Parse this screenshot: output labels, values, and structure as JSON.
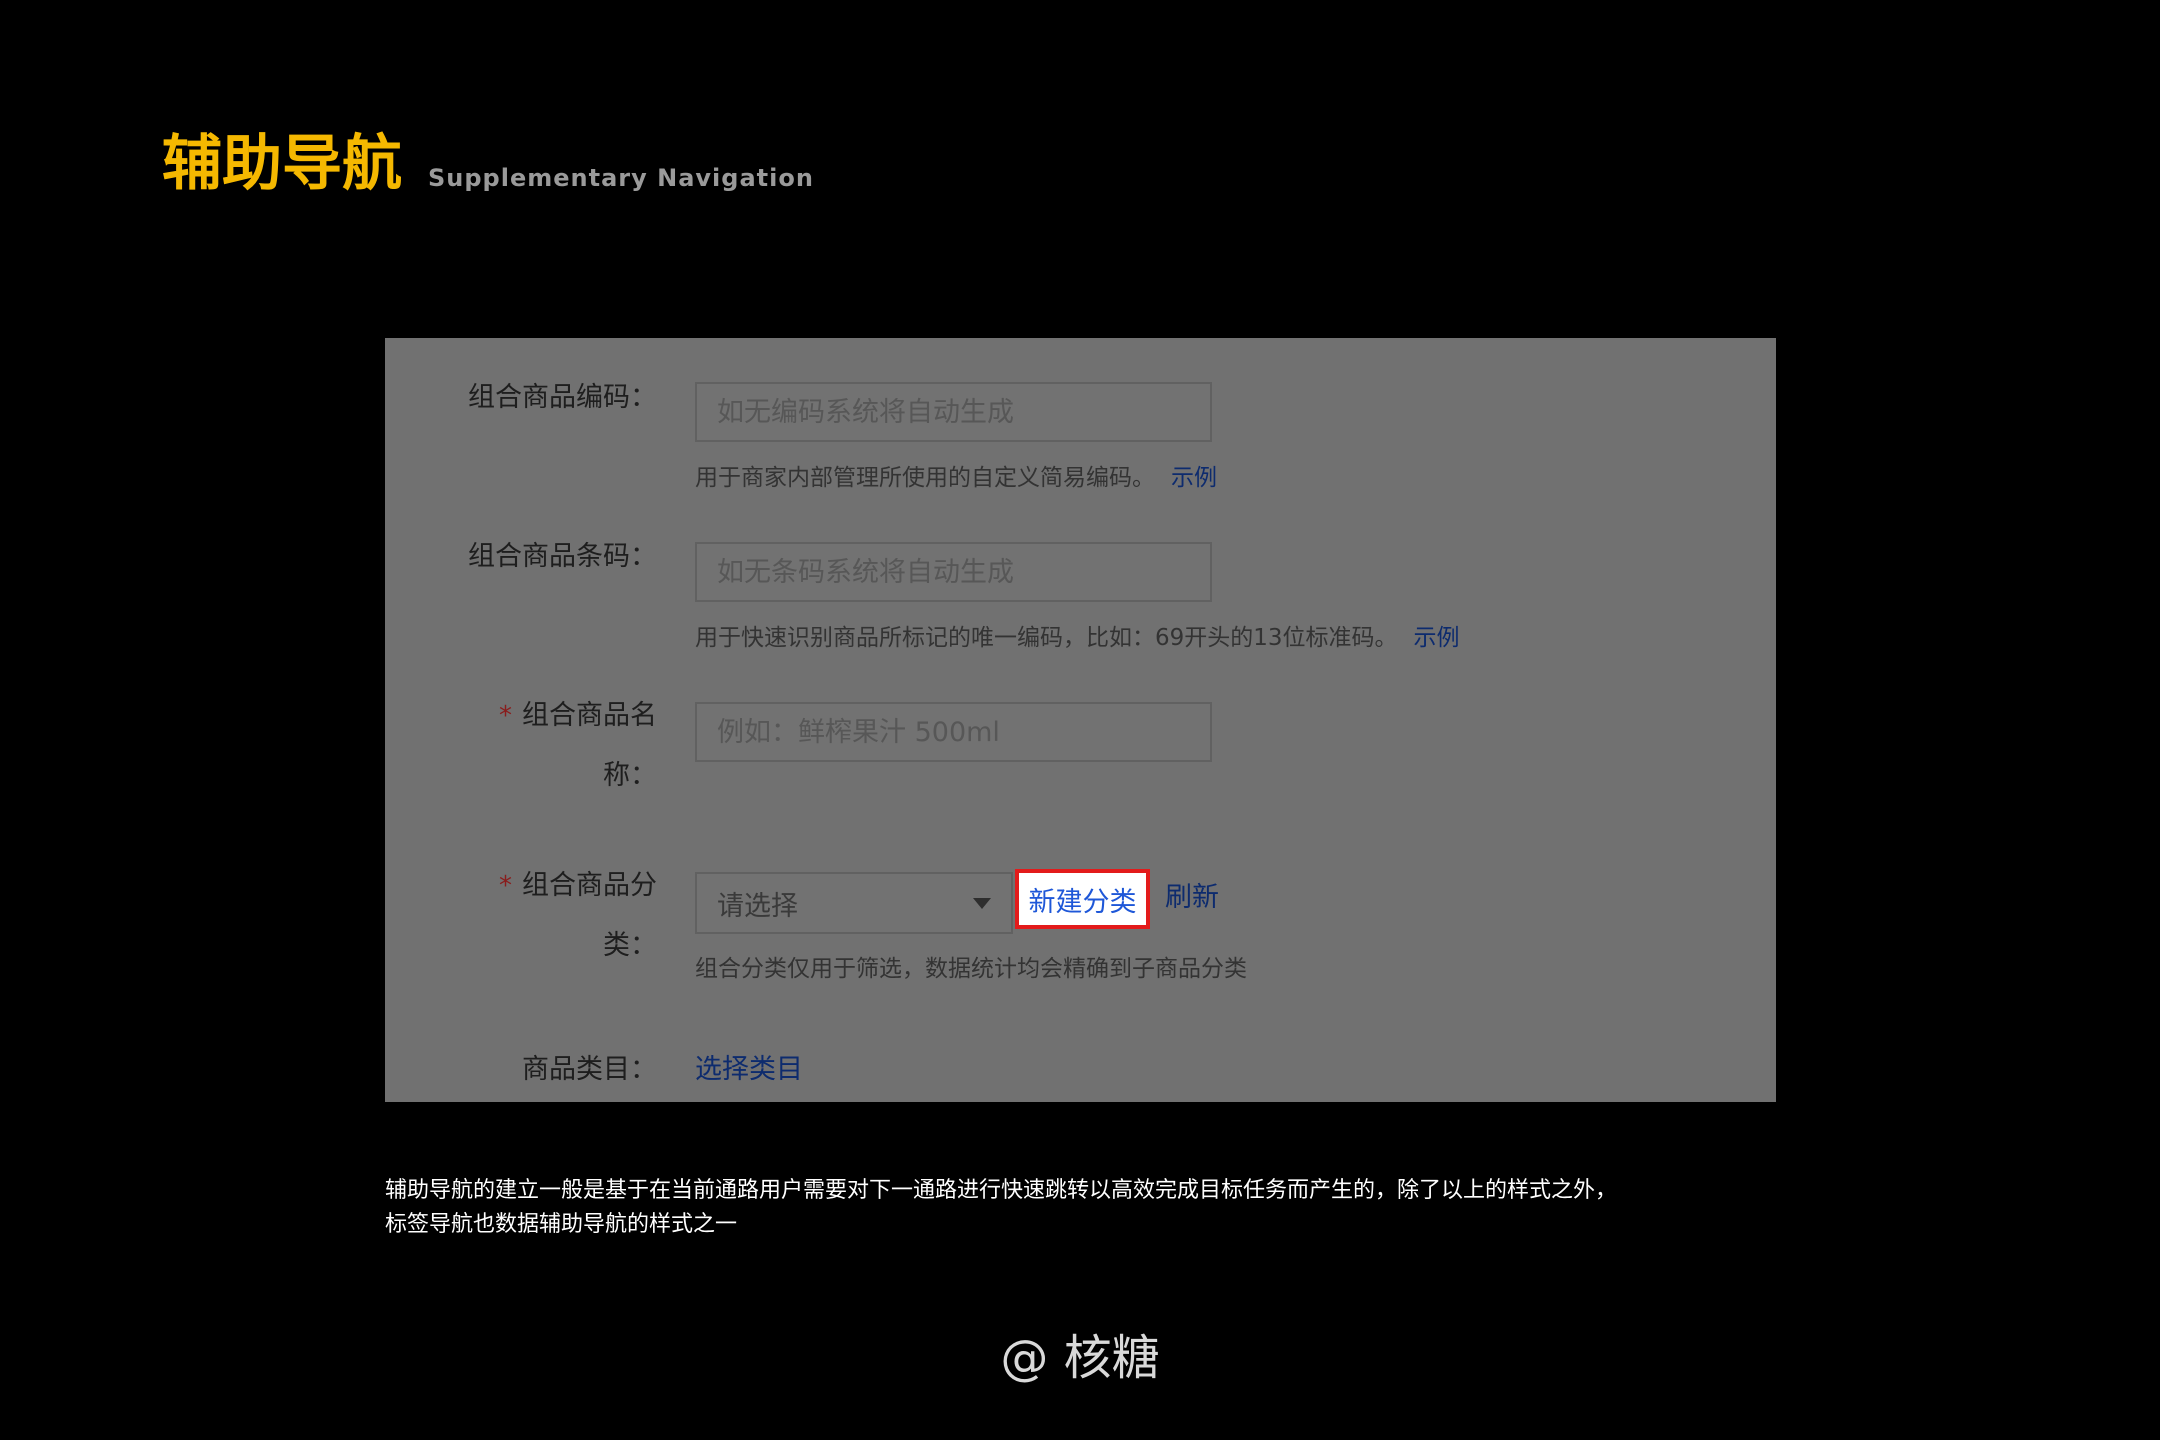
{
  "header": {
    "title": "辅助导航",
    "subtitle": "Supplementary Navigation"
  },
  "form": {
    "code": {
      "label": "组合商品编码：",
      "placeholder": "如无编码系统将自动生成",
      "hint": "用于商家内部管理所使用的自定义简易编码。",
      "example_link": "示例"
    },
    "barcode": {
      "label": "组合商品条码：",
      "placeholder": "如无条码系统将自动生成",
      "hint": "用于快速识别商品所标记的唯一编码，比如：69开头的13位标准码。",
      "example_link": "示例"
    },
    "name": {
      "required_mark": "*",
      "label_line1": "组合商品名",
      "label_line2": "称：",
      "placeholder": "例如：鲜榨果汁 500ml"
    },
    "category": {
      "required_mark": "*",
      "label_line1": "组合商品分",
      "label_line2": "类：",
      "select_value": "请选择",
      "new_category": "新建分类",
      "refresh": "刷新",
      "hint": "组合分类仅用于筛选，数据统计均会精确到子商品分类"
    },
    "product_category": {
      "label": "商品类目：",
      "link": "选择类目"
    }
  },
  "description": {
    "line1": "辅助导航的建立一般是基于在当前通路用户需要对下一通路进行快速跳转以高效完成目标任务而产生的，除了以上的样式之外，",
    "line2": "标签导航也数据辅助导航的样式之一"
  },
  "credit": "@ 核糖",
  "colors": {
    "background": "#000000",
    "title": "#F5B800",
    "highlight_border": "#e31b1b",
    "link": "#1e57d8"
  }
}
